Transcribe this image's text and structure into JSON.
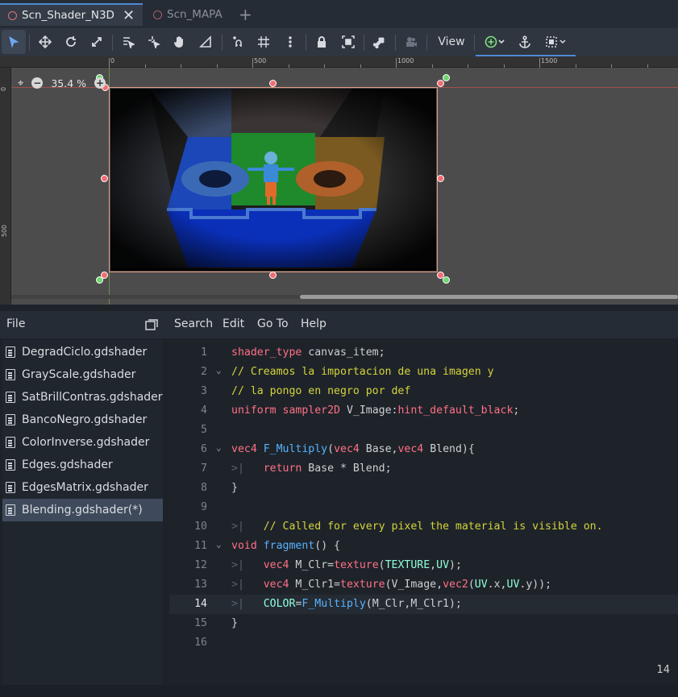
{
  "scene_tabs": [
    {
      "label": "Scn_Shader_N3D",
      "active": true
    },
    {
      "label": "Scn_MAPA",
      "active": false
    }
  ],
  "toolbar": {
    "view_label": "View",
    "tools": [
      "select-icon",
      "move-icon",
      "rotate-icon",
      "scale-icon",
      "list-select-icon",
      "pivot-icon",
      "pan-icon",
      "ruler-icon",
      "smart-snap-icon",
      "grid-snap-icon",
      "more-icon",
      "lock-icon",
      "group-icon",
      "bone-icon",
      "camera-icon",
      "add-node-icon",
      "anchor-icon",
      "layout-icon"
    ]
  },
  "viewport": {
    "zoom_label": "35.4 %",
    "ruler_top_labels": [
      "0",
      "500",
      "1000",
      "1500"
    ],
    "ruler_left_labels": [
      "0",
      "500"
    ]
  },
  "script_panel": {
    "file_label": "File",
    "menu": [
      "Search",
      "Edit",
      "Go To",
      "Help"
    ],
    "files": [
      {
        "name": "DegradCiclo.gdshader",
        "selected": false
      },
      {
        "name": "GrayScale.gdshader",
        "selected": false
      },
      {
        "name": "SatBrillContras.gdshader",
        "selected": false
      },
      {
        "name": "BancoNegro.gdshader",
        "selected": false
      },
      {
        "name": "ColorInverse.gdshader",
        "selected": false
      },
      {
        "name": "Edges.gdshader",
        "selected": false
      },
      {
        "name": "EdgesMatrix.gdshader",
        "selected": false
      },
      {
        "name": "Blending.gdshader(*)",
        "selected": true
      }
    ]
  },
  "editor": {
    "current_line": 14,
    "status_line": "14",
    "lines": [
      {
        "n": "1",
        "text": "shader_type canvas_item;"
      },
      {
        "n": "2",
        "text": "// Creamos la importacion de una imagen y"
      },
      {
        "n": "3",
        "text": "// la pongo en negro por def"
      },
      {
        "n": "4",
        "text": "uniform sampler2D V_Image:hint_default_black;"
      },
      {
        "n": "5",
        "text": ""
      },
      {
        "n": "6",
        "text": "vec4 F_Multiply(vec4 Base,vec4 Blend){"
      },
      {
        "n": "7",
        "text": "return Base * Blend;"
      },
      {
        "n": "8",
        "text": "}"
      },
      {
        "n": "9",
        "text": ""
      },
      {
        "n": "10",
        "text": "// Called for every pixel the material is visible on."
      },
      {
        "n": "11",
        "text": "void fragment() {"
      },
      {
        "n": "12",
        "text": "vec4 M_Clr=texture(TEXTURE,UV);"
      },
      {
        "n": "13",
        "text": "vec4 M_Clr1=texture(V_Image,vec2(UV.x,UV.y));"
      },
      {
        "n": "14",
        "text": "COLOR=F_Multiply(M_Clr,M_Clr1);"
      },
      {
        "n": "15",
        "text": "}"
      },
      {
        "n": "16",
        "text": ""
      }
    ]
  },
  "colors": {
    "accent": "#4f89d6",
    "keyword": "#ff7085",
    "type": "#42ffc2",
    "function": "#57b3ff",
    "comment": "#d4d43a"
  }
}
